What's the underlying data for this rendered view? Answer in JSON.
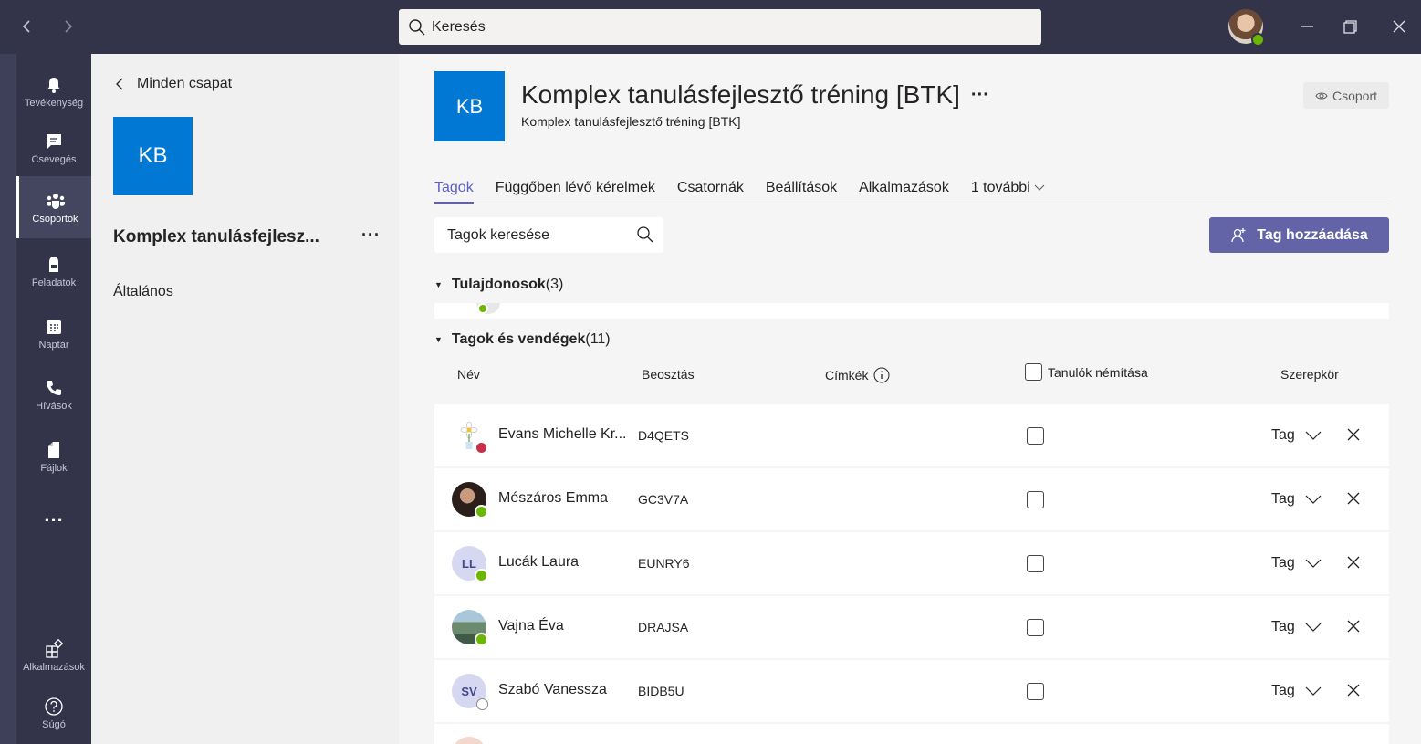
{
  "search": {
    "label": "Keresés"
  },
  "rail": [
    {
      "label": "Tevékenység",
      "icon": "bell-icon"
    },
    {
      "label": "Csevegés",
      "icon": "chat-icon"
    },
    {
      "label": "Csoportok",
      "icon": "teams-icon"
    },
    {
      "label": "Feladatok",
      "icon": "backpack-icon"
    },
    {
      "label": "Naptár",
      "icon": "calendar-icon"
    },
    {
      "label": "Hívások",
      "icon": "phone-icon"
    },
    {
      "label": "Fájlok",
      "icon": "file-icon"
    },
    {
      "label": "...",
      "icon": "more-icon"
    },
    {
      "label": "Alkalmazások",
      "icon": "apps-icon"
    },
    {
      "label": "Súgó",
      "icon": "help-icon"
    }
  ],
  "team_panel": {
    "back_label": "Minden csapat",
    "tile_initials": "KB",
    "team_name": "Komplex tanulásfejlesz...",
    "more": "···",
    "channel": "Általános"
  },
  "header": {
    "tile_initials": "KB",
    "title": "Komplex tanulásfejlesztő tréning [BTK]",
    "more": "···",
    "subtitle": "Komplex tanulásfejlesztő tréning [BTK]",
    "visibility": "Csoport"
  },
  "tabs": [
    "Tagok",
    "Függőben lévő kérelmek",
    "Csatornák",
    "Beállítások",
    "Alkalmazások",
    "1 további"
  ],
  "member_search_placeholder": "Tagok keresése",
  "add_button": "Tag hozzáadása",
  "owners": {
    "title": "Tulajdonosok",
    "count": "(3)"
  },
  "members": {
    "title": "Tagok és vendégek",
    "count": "(11)"
  },
  "columns": {
    "name": "Név",
    "title": "Beosztás",
    "tags": "Címkék",
    "mute": "Tanulók némítása",
    "role": "Szerepkör"
  },
  "rows": [
    {
      "name": "Evans Michelle Kr...",
      "code": "D4QETS",
      "role": "Tag",
      "initials": "",
      "status": "red"
    },
    {
      "name": "Mészáros Emma",
      "code": "GC3V7A",
      "role": "Tag",
      "initials": "",
      "status": "green"
    },
    {
      "name": "Lucák Laura",
      "code": "EUNRY6",
      "role": "Tag",
      "initials": "LL",
      "status": "green"
    },
    {
      "name": "Vajna Éva",
      "code": "DRAJSA",
      "role": "Tag",
      "initials": "",
      "status": "green"
    },
    {
      "name": "Szabó Vanessza",
      "code": "BIDB5U",
      "role": "Tag",
      "initials": "SV",
      "status": "offline"
    }
  ],
  "colors": {
    "accent": "#6264a7",
    "tile": "#0078d4",
    "rail": "#33344a",
    "online": "#6bb700",
    "busy": "#c4314b"
  }
}
